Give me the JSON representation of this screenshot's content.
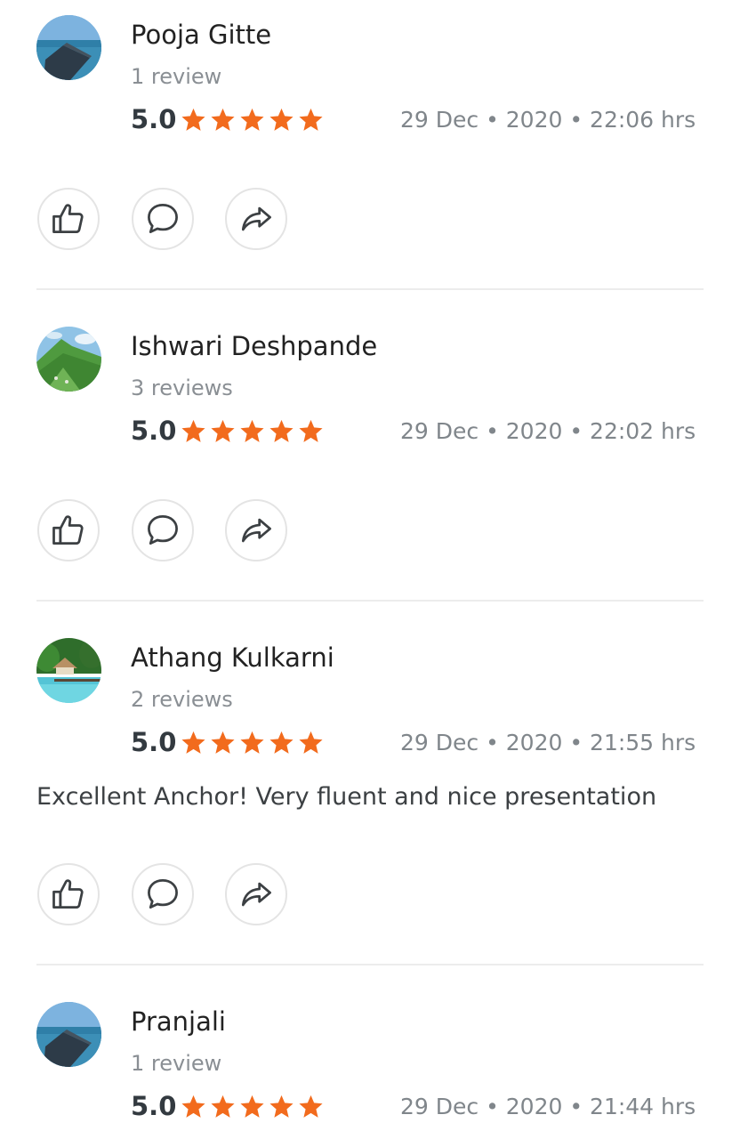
{
  "reviews": [
    {
      "name": "Pooja Gitte",
      "count": "1 review",
      "rating": "5.0",
      "stars": 5,
      "date": "29 Dec • 2020 • 22:06 hrs",
      "comment": "",
      "avatar_icon": "ocean-pier-photo"
    },
    {
      "name": "Ishwari Deshpande",
      "count": "3 reviews",
      "rating": "5.0",
      "stars": 5,
      "date": "29 Dec • 2020 • 22:02 hrs",
      "comment": "",
      "avatar_icon": "green-hill-photo"
    },
    {
      "name": "Athang Kulkarni",
      "count": "2 reviews",
      "rating": "5.0",
      "stars": 5,
      "date": "29 Dec • 2020 • 21:55 hrs",
      "comment": "Excellent Anchor! Very fluent and nice presentation",
      "avatar_icon": "beach-resort-photo"
    },
    {
      "name": "Pranjali",
      "count": "1 review",
      "rating": "5.0",
      "stars": 5,
      "date": "29 Dec • 2020 • 21:44 hrs",
      "comment": "",
      "avatar_icon": "ocean-pier-photo"
    }
  ],
  "actions": [
    "like-icon",
    "comment-icon",
    "share-icon"
  ],
  "colors": {
    "star": "#f26b1d",
    "name": "#222222",
    "muted": "#8a8f94",
    "divider": "#ececec"
  }
}
